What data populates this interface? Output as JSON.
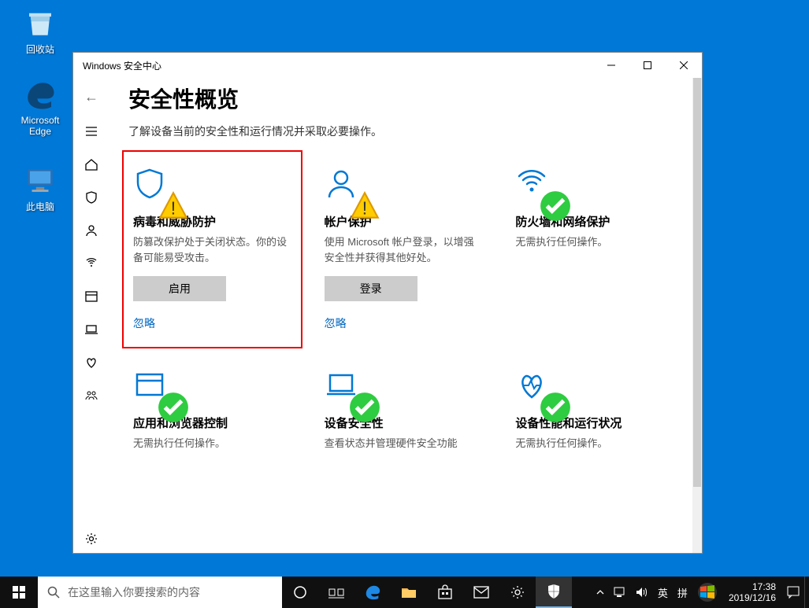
{
  "desktop": {
    "recycle": "回收站",
    "edge": "Microsoft Edge",
    "pc": "此电脑"
  },
  "window": {
    "title": "Windows 安全中心",
    "heading": "安全性概览",
    "subtitle": "了解设备当前的安全性和运行情况并采取必要操作。"
  },
  "cards": {
    "virus": {
      "title": "病毒和威胁防护",
      "desc": "防篡改保护处于关闭状态。你的设备可能易受攻击。",
      "button": "启用",
      "link": "忽略"
    },
    "account": {
      "title": "帐户保护",
      "desc": "使用 Microsoft 帐户登录，以增强安全性并获得其他好处。",
      "button": "登录",
      "link": "忽略"
    },
    "firewall": {
      "title": "防火墙和网络保护",
      "desc": "无需执行任何操作。"
    },
    "app": {
      "title": "应用和浏览器控制",
      "desc": "无需执行任何操作。"
    },
    "device": {
      "title": "设备安全性",
      "desc": "查看状态并管理硬件安全功能"
    },
    "health": {
      "title": "设备性能和运行状况",
      "desc": "无需执行任何操作。"
    }
  },
  "taskbar": {
    "search_placeholder": "在这里输入你要搜索的内容",
    "ime1": "英",
    "ime2": "拼",
    "time": "17:38",
    "date": "2019/12/16"
  }
}
